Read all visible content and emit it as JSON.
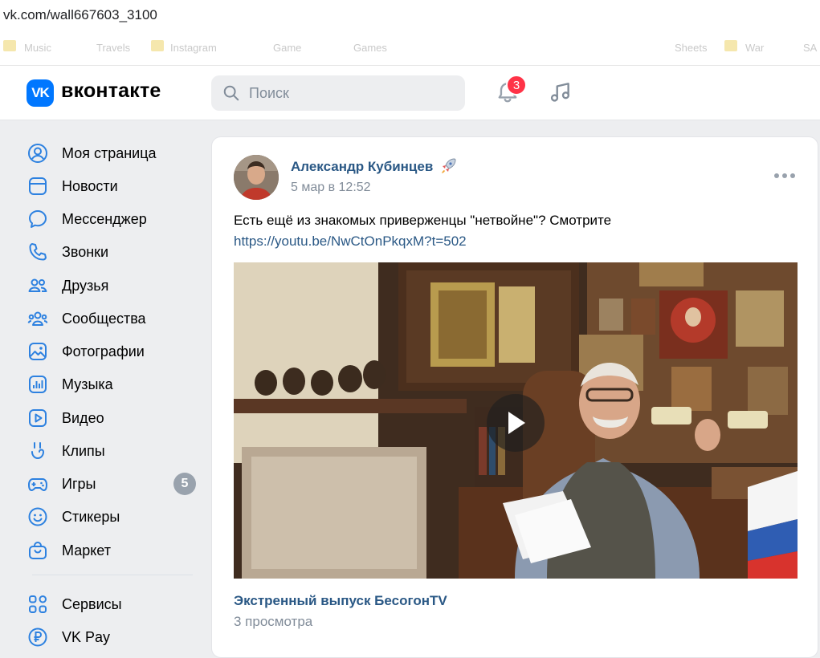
{
  "browser": {
    "url": "vk.com/wall667603_3100",
    "bookmarks": [
      "Music",
      "Travels",
      "Instagram",
      "Game",
      "Games",
      "Sheets",
      "War",
      "SA"
    ]
  },
  "header": {
    "brand": "вконтакте",
    "logo_text": "VK",
    "search_placeholder": "Поиск",
    "notifications_count": "3"
  },
  "sidebar": {
    "items": [
      {
        "label": "Моя страница",
        "icon": "user-circle-icon"
      },
      {
        "label": "Новости",
        "icon": "newsfeed-icon"
      },
      {
        "label": "Мессенджер",
        "icon": "message-icon"
      },
      {
        "label": "Звонки",
        "icon": "phone-icon"
      },
      {
        "label": "Друзья",
        "icon": "friends-icon"
      },
      {
        "label": "Сообщества",
        "icon": "communities-icon"
      },
      {
        "label": "Фотографии",
        "icon": "photo-icon"
      },
      {
        "label": "Музыка",
        "icon": "music-chart-icon"
      },
      {
        "label": "Видео",
        "icon": "video-icon"
      },
      {
        "label": "Клипы",
        "icon": "clips-icon"
      },
      {
        "label": "Игры",
        "icon": "gamepad-icon",
        "badge": "5"
      },
      {
        "label": "Стикеры",
        "icon": "smile-icon"
      },
      {
        "label": "Маркет",
        "icon": "market-bag-icon"
      }
    ],
    "extra_items": [
      {
        "label": "Сервисы",
        "icon": "services-grid-icon"
      },
      {
        "label": "VK Pay",
        "icon": "vkpay-icon"
      }
    ]
  },
  "post": {
    "author": "Александр Кубинцев",
    "date": "5 мар в 12:52",
    "text": "Есть ещё из знакомых приверженцы \"нетвойне\"? Смотрите",
    "link": "https://youtu.be/NwCtOnPkqxM?t=502",
    "video_title": "Экстренный выпуск БесогонTV",
    "video_views": "3 просмотра"
  },
  "colors": {
    "accent": "#0077ff",
    "link": "#2a5885",
    "muted": "#818c99",
    "badge_red": "#ff3347",
    "background": "#edeef0"
  }
}
